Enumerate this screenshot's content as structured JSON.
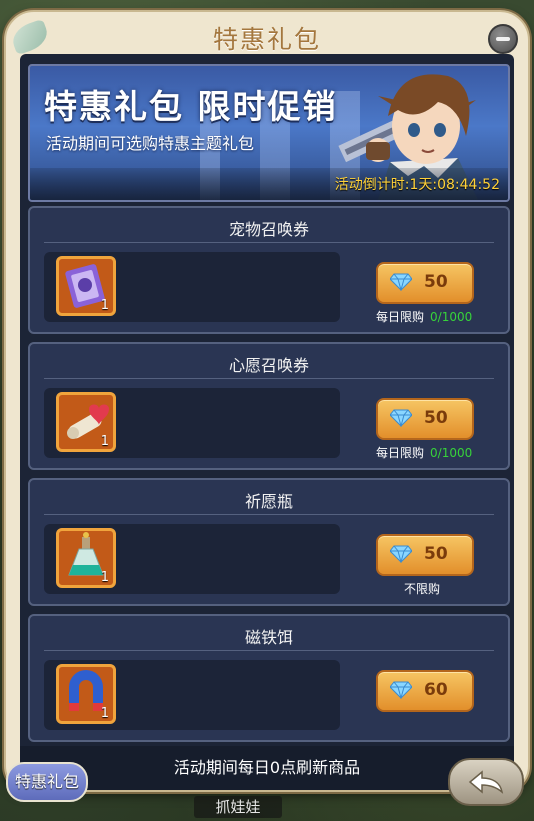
{
  "window": {
    "title": "特惠礼包"
  },
  "banner": {
    "title": "特惠礼包  限时促销",
    "subtitle": "活动期间可选购特惠主题礼包",
    "countdown": "活动倒计时:1天:08:44:52"
  },
  "items": [
    {
      "name": "宠物召唤券",
      "count": "1",
      "price": "50",
      "limit_label": "每日限购",
      "limit_value": "0/1000",
      "icon": "pet-summon-ticket-icon"
    },
    {
      "name": "心愿召唤券",
      "count": "1",
      "price": "50",
      "limit_label": "每日限购",
      "limit_value": "0/1000",
      "icon": "wish-summon-scroll-icon"
    },
    {
      "name": "祈愿瓶",
      "count": "1",
      "price": "50",
      "limit_label": "不限购",
      "limit_value": "",
      "icon": "wish-bottle-icon"
    },
    {
      "name": "磁铁饵",
      "count": "1",
      "price": "60",
      "limit_label": "",
      "limit_value": "",
      "icon": "magnet-bait-icon"
    }
  ],
  "footer": {
    "notice": "活动期间每日0点刷新商品"
  },
  "bottom": {
    "tab_label": "特惠礼包",
    "behind_label": "抓娃娃"
  },
  "colors": {
    "accent": "#e28f2b",
    "limit_green": "#37d23a",
    "countdown_yellow": "#ffd23a"
  }
}
